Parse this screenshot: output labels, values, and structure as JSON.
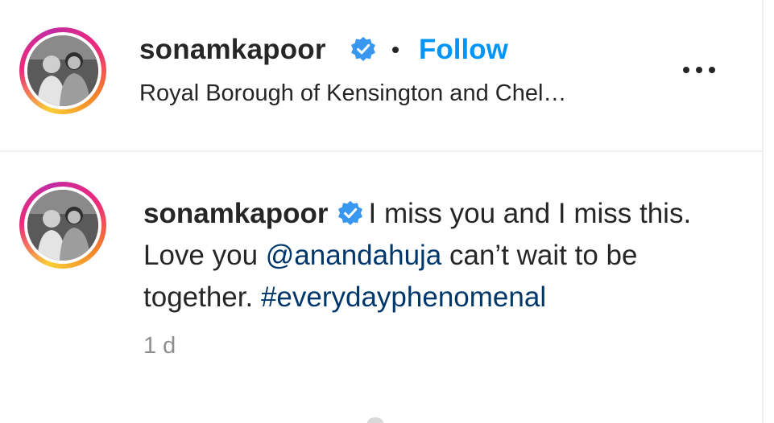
{
  "post_header": {
    "username": "sonamkapoor",
    "verified_icon": "verified-badge-icon",
    "separator": "•",
    "follow_label": "Follow",
    "location": "Royal Borough of Kensington and Chel…",
    "more_icon": "more-options-icon"
  },
  "caption": {
    "username": "sonamkapoor",
    "text_part1": "I miss you and I miss this. Love you ",
    "mention": "@anandahuja",
    "text_part2": " can’t wait to be together. ",
    "hashtag": "#everydayphenomenal",
    "timestamp": "1 d"
  },
  "colors": {
    "accent_blue": "#0095f6",
    "link_blue": "#00376b",
    "text": "#262626",
    "muted": "#8e8e8e",
    "divider": "#efefef"
  }
}
